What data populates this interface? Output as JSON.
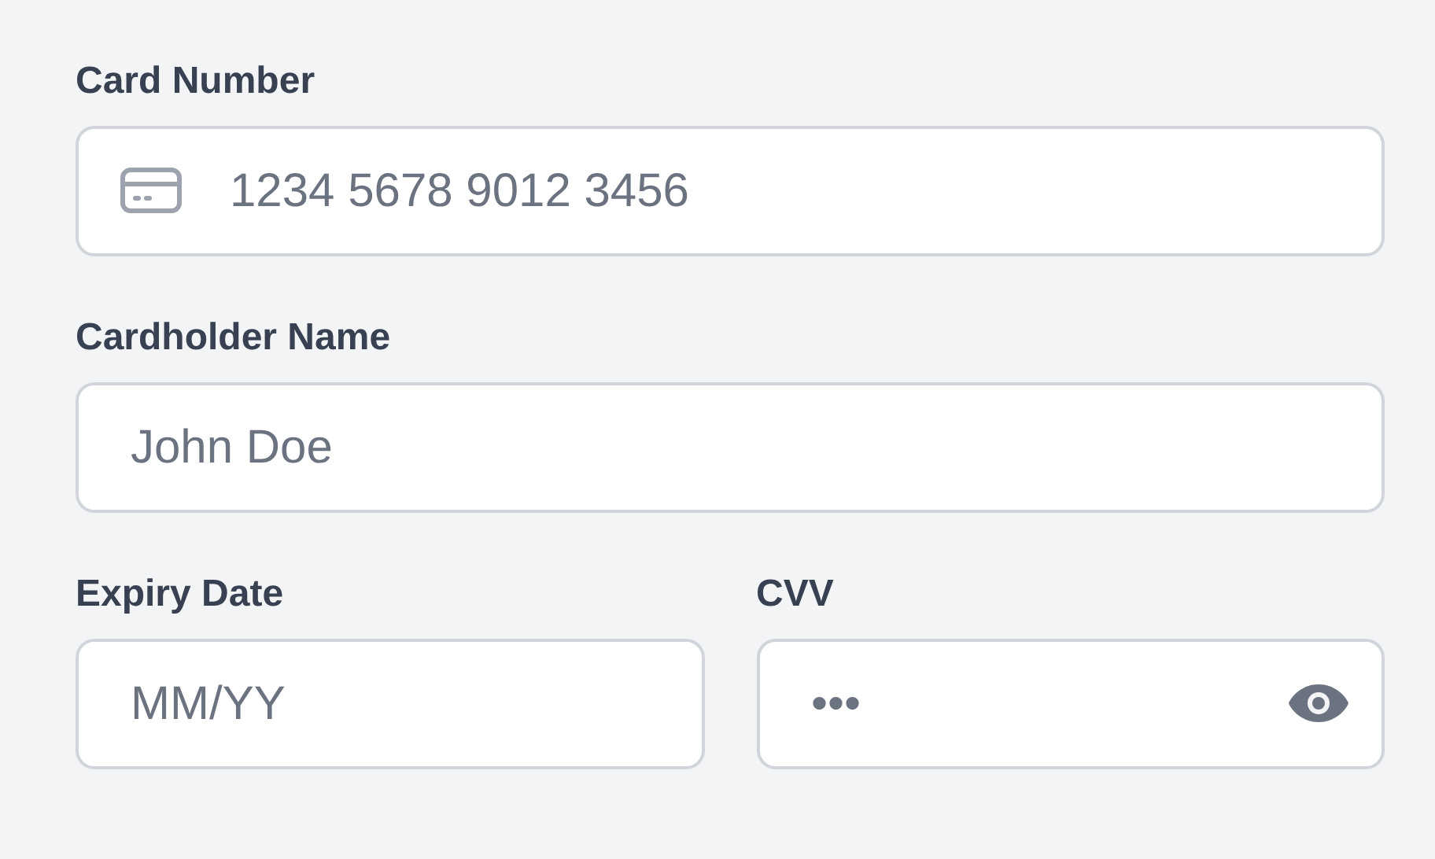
{
  "fields": [
    {
      "kind": "card",
      "label": "Card Number",
      "placeholder": "1234 5678 9012 3456"
    },
    {
      "kind": "text",
      "label": "Cardholder Name",
      "placeholder": "John Doe"
    }
  ],
  "row": [
    {
      "kind": "text",
      "label": "Expiry Date",
      "placeholder": "MM/YY"
    },
    {
      "kind": "secret",
      "label": "CVV",
      "placeholder": "•••"
    }
  ]
}
